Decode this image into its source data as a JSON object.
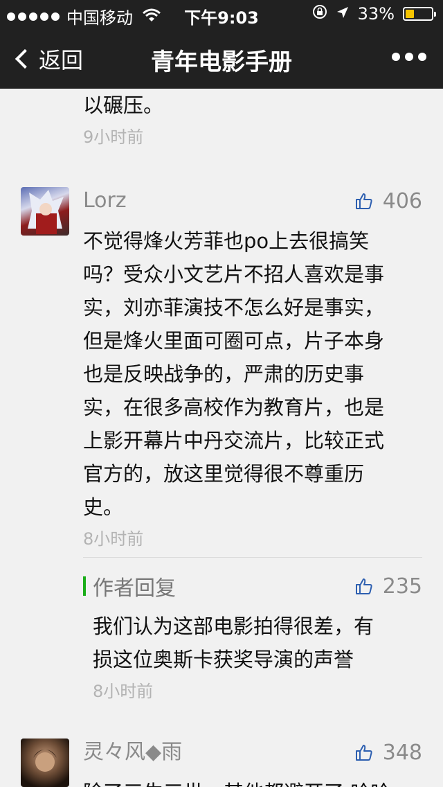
{
  "status_bar": {
    "carrier": "中国移动",
    "time": "下午9:03",
    "battery": "33%",
    "battery_level": 0.33
  },
  "nav": {
    "back_label": "返回",
    "title": "青年电影手册",
    "more_icon": "more-dots-icon"
  },
  "previous_comment": {
    "text_tail": "以碾压。",
    "time": "9小时前"
  },
  "comments": [
    {
      "user": "Lorz",
      "likes": "406",
      "lines": [
        "不觉得烽火芳菲也po上去很搞笑",
        "吗？受众小文艺片不招人喜欢是事",
        "实，刘亦菲演技不怎么好是事实，",
        "但是烽火里面可圈可点，片子本身",
        "也是反映战争的，严肃的历史事",
        "实，在很多高校作为教育片，也是",
        "上影开幕片中丹交流片，比较正式",
        "官方的，放这里觉得很不尊重历",
        "史。"
      ],
      "time": "8小时前",
      "reply": {
        "label": "作者回复",
        "likes": "235",
        "lines": [
          "我们认为这部电影拍得很差，有",
          "损这位奥斯卡获奖导演的声誉"
        ],
        "time": "8小时前"
      }
    },
    {
      "user": "灵々风◆雨",
      "likes": "348",
      "lines": [
        "除了三生三世，其他都避开了,哈哈"
      ]
    }
  ],
  "colors": {
    "nav_bg": "#212121",
    "page_bg": "#f1f1f1",
    "reply_accent": "#1aad19",
    "meta_text": "#b3b3b3"
  }
}
